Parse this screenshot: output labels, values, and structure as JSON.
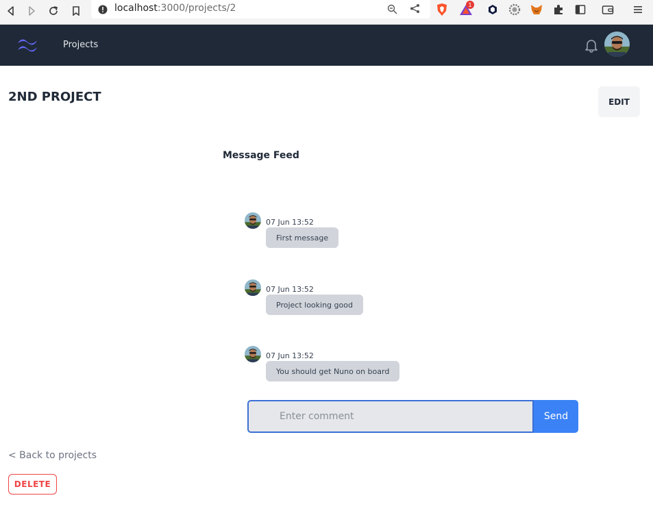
{
  "browser": {
    "url_host": "localhost",
    "url_path": ":3000/projects/2",
    "extensions": [
      "zoom-icon",
      "share-icon",
      "brave-shield-icon",
      "brave-rewards-icon",
      "crypto-icon",
      "gear-wallet-icon",
      "metamask-icon",
      "puzzle-icon",
      "sidebar-icon",
      "wallet-icon",
      "menu-icon"
    ],
    "rewards_badge": "1"
  },
  "nav": {
    "projects_label": "Projects"
  },
  "page": {
    "title": "2ND PROJECT",
    "edit_label": "EDIT",
    "feed_title": "Message Feed",
    "back_label": "< Back to projects",
    "delete_label": "DELETE"
  },
  "messages": [
    {
      "time": "07 Jun 13:52",
      "text": "First message"
    },
    {
      "time": "07 Jun 13:52",
      "text": "Project looking good"
    },
    {
      "time": "07 Jun 13:52",
      "text": "You should get Nuno on board"
    }
  ],
  "comment": {
    "placeholder": "Enter comment",
    "value": "",
    "send_label": "Send"
  },
  "colors": {
    "nav_bg": "#1f2937",
    "send_bg": "#3b82f6",
    "delete_accent": "#ef4444",
    "logo": "#6366f1"
  }
}
